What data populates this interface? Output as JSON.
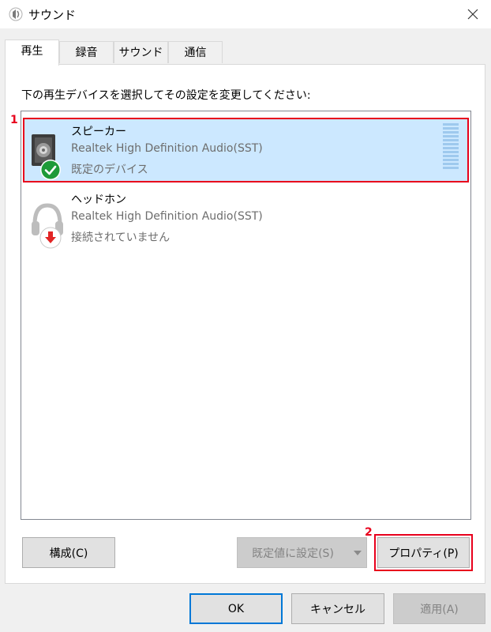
{
  "window": {
    "title": "サウンド"
  },
  "tabs": [
    {
      "label": "再生"
    },
    {
      "label": "録音"
    },
    {
      "label": "サウンド"
    },
    {
      "label": "通信"
    }
  ],
  "instruction": "下の再生デバイスを選択してその設定を変更してください:",
  "devices": [
    {
      "name": "スピーカー",
      "driver": "Realtek High Definition Audio(SST)",
      "status": "既定のデバイス",
      "icon": "speaker-icon",
      "badge": "default-check-icon"
    },
    {
      "name": "ヘッドホン",
      "driver": "Realtek High Definition Audio(SST)",
      "status": "接続されていません",
      "icon": "headphones-icon",
      "badge": "disconnected-arrow-icon"
    }
  ],
  "markers": {
    "m1": "1",
    "m2": "2"
  },
  "buttons": {
    "configure": "構成(C)",
    "set_default": "既定値に設定(S)",
    "properties": "プロパティ(P)",
    "ok": "OK",
    "cancel": "キャンセル",
    "apply": "適用(A)"
  },
  "colors": {
    "selection": "#cce8ff",
    "highlight": "#e8001c",
    "accent": "#0078d7"
  }
}
